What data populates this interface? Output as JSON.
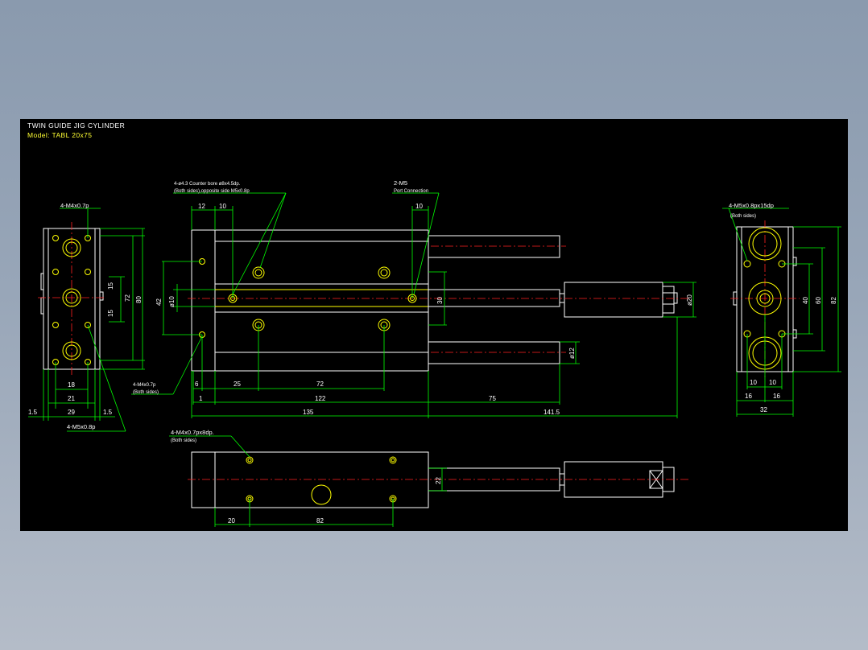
{
  "title": "TWIN GUIDE JIG CYLINDER",
  "model": "Model: TABL 20x75",
  "colors": {
    "background": "#000000",
    "outline": "#ffffff",
    "dimension": "#00ff00",
    "center_line": "#ff2020",
    "hole": "#ffff00",
    "desktop": "#8a9aae"
  },
  "callouts": {
    "left_top_thread": "4-M4x0.7p",
    "left_bottom_thread": "4-M5x0.8p",
    "counter_bore": "4-ø4.3  Counter bore ø8x4.5dp.",
    "counter_bore_note": "(Both sides),opposite side M5x0.8p",
    "port": "2-M5",
    "port_note": "Port Connection",
    "side_thread": "4-M4x0.7p",
    "side_thread_note": "(Both sides)",
    "bottom_thread": "4-M4x0.7px8dp.",
    "bottom_thread_note": "(Both sides)",
    "right_thread": "4-M5x0.8px15dp",
    "right_thread_note": "(Both sides)"
  },
  "dims": {
    "left_view": {
      "d15a": "15",
      "d15b": "15",
      "d72": "72",
      "d80": "80",
      "d18": "18",
      "d21": "21",
      "d29": "29",
      "d15l": "1.5",
      "d15r": "1.5"
    },
    "front_view": {
      "d12": "12",
      "d10a": "10",
      "d10b": "10",
      "d42": "42",
      "phi10": "ø10",
      "d30": "30",
      "phi20": "ø20",
      "phi12": "ø12",
      "d1": "1",
      "d6": "6",
      "d25": "25",
      "d72": "72",
      "d122": "122",
      "d75": "75",
      "d135": "135",
      "d1415": "141.5"
    },
    "right_view": {
      "d40": "40",
      "d60": "60",
      "d82": "82",
      "d10a": "10",
      "d10b": "10",
      "d16a": "16",
      "d16b": "16",
      "d32": "32"
    },
    "bottom_view": {
      "d22": "22",
      "d20": "20",
      "d82": "82"
    }
  }
}
